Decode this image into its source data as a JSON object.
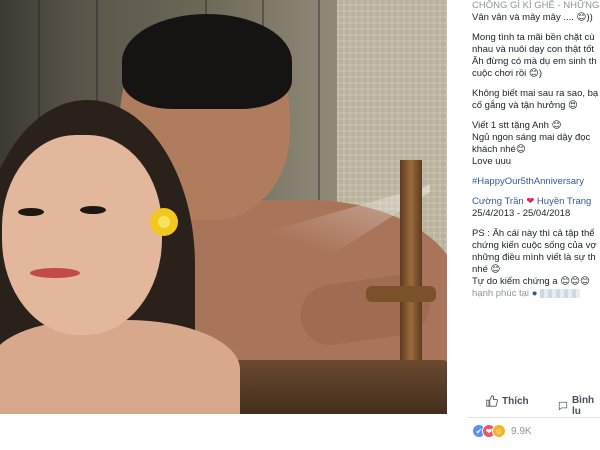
{
  "caption": {
    "line_top": "CHỒNG GÌ KÌ GHÊ - NHỮNG",
    "line_1": "Vân vân và mây mây .... 😊))",
    "para_1": [
      "Mong tình ta mãi bền chặt cù",
      "nhau và nuôi dạy con thật tốt",
      "Ăh đừng có mà dụ em sinh th",
      "cuộc chơi rồi 😊)"
    ],
    "para_2": [
      "Không biết mai sau ra sao, bạ",
      "cố gắng và tận hưởng 😍"
    ],
    "para_3": [
      "Viết 1 stt tặng Anh 😊",
      "Ngủ ngon sáng mai dậy đọc",
      "khách nhé😊",
      "Love uuu"
    ],
    "hashtag": "#HappyOur5thAnniversary",
    "names": [
      "Cường Trần",
      "Huyền Trang"
    ],
    "dates": "25/4/2013 - 25/04/2018",
    "ps": [
      "PS : Ăh cái này thì cả tập thể",
      "chứng kiến cuộc sống của vợ",
      "những điều mình viết là sự th",
      "nhé 😊"
    ],
    "closing": "Tự do kiểm chứng a 😊😊😊",
    "location_prefix": "hạnh phúc tại"
  },
  "actions": {
    "like_label": "Thích",
    "comment_label": "Bình lu"
  },
  "reactions": {
    "count": "9.9K",
    "icons": [
      "like-icon",
      "love-icon",
      "haha-icon"
    ]
  },
  "colors": {
    "link": "#365899",
    "muted": "#90949c",
    "like_blue": "#5890ff",
    "love_red": "#f25268",
    "haha_yellow": "#f7b125"
  }
}
